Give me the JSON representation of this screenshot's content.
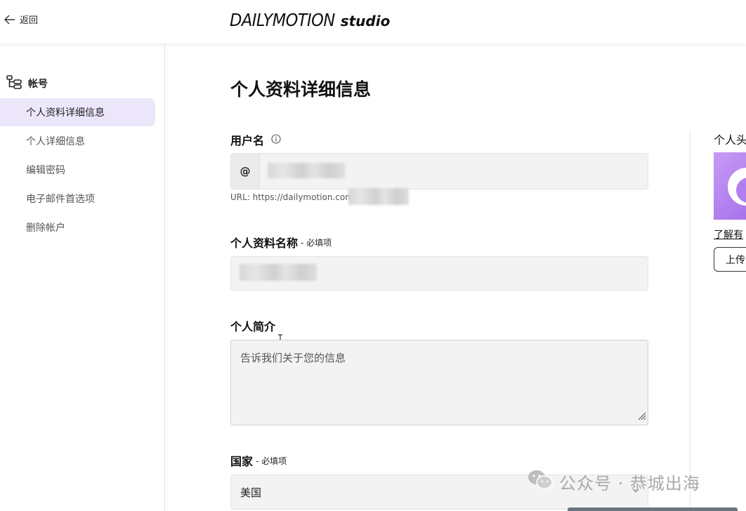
{
  "header": {
    "back_label": "返回",
    "logo_main": "DAILYMOTION",
    "logo_sub": "studio"
  },
  "sidebar": {
    "section_title": "帐号",
    "items": [
      {
        "label": "个人资料详细信息",
        "active": true
      },
      {
        "label": "个人详细信息",
        "active": false
      },
      {
        "label": "编辑密码",
        "active": false
      },
      {
        "label": "电子邮件首选项",
        "active": false
      },
      {
        "label": "删除帐户",
        "active": false
      }
    ]
  },
  "main": {
    "page_title": "个人资料详细信息",
    "username": {
      "label": "用户名",
      "prefix": "@",
      "url_prefix": "URL: https://dailymotion.com"
    },
    "profile_name": {
      "label": "个人资料名称",
      "required": "- 必填项"
    },
    "bio": {
      "label": "个人简介",
      "placeholder": "告诉我们关于您的信息"
    },
    "country": {
      "label": "国家",
      "required": "- 必填项",
      "value": "美国"
    }
  },
  "right_panel": {
    "avatar_label": "个人头",
    "learn_link": "了解有",
    "upload_label": "上传"
  },
  "watermark": {
    "text": "公众号 · 恭城出海"
  },
  "colors": {
    "active_nav_bg": "#ece6fb",
    "avatar_gradient": "#b27ff0"
  }
}
